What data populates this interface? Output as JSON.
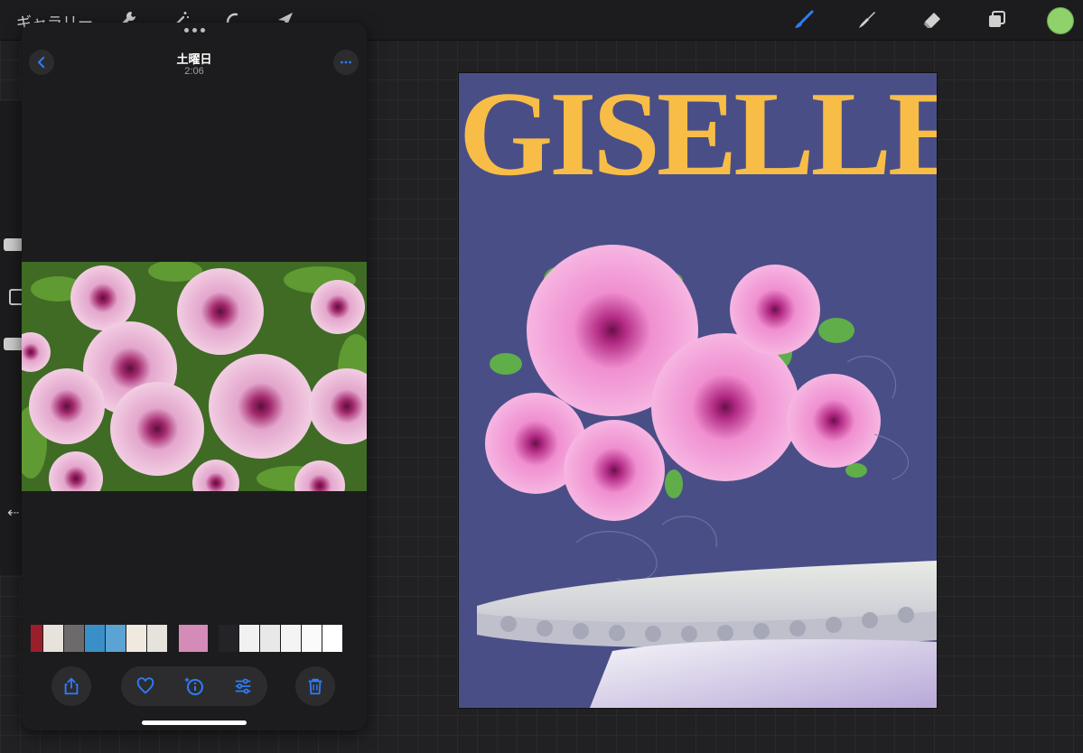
{
  "app": {
    "gallery_label": "ギャラリー",
    "toolbar_icons": [
      "wrench-icon",
      "magic-wand-icon",
      "selection-icon",
      "arrow-cursor-icon"
    ],
    "right_tools": [
      "brush-icon",
      "smudge-icon",
      "eraser-icon",
      "layers-icon"
    ],
    "active_color": "#8fd16a",
    "accent": "#2f7cf6"
  },
  "photo_viewer": {
    "title": "土曜日",
    "time": "2:06",
    "back_icon": "chevron-left-icon",
    "more_icon": "ellipsis-icon",
    "actions": [
      "share-icon",
      "heart-icon",
      "info-sparkle-icon",
      "adjust-icon",
      "trash-icon"
    ]
  },
  "canvas": {
    "title_text": "GISELLE",
    "background_color": "#4a4e86",
    "title_color": "#f7bd47"
  }
}
